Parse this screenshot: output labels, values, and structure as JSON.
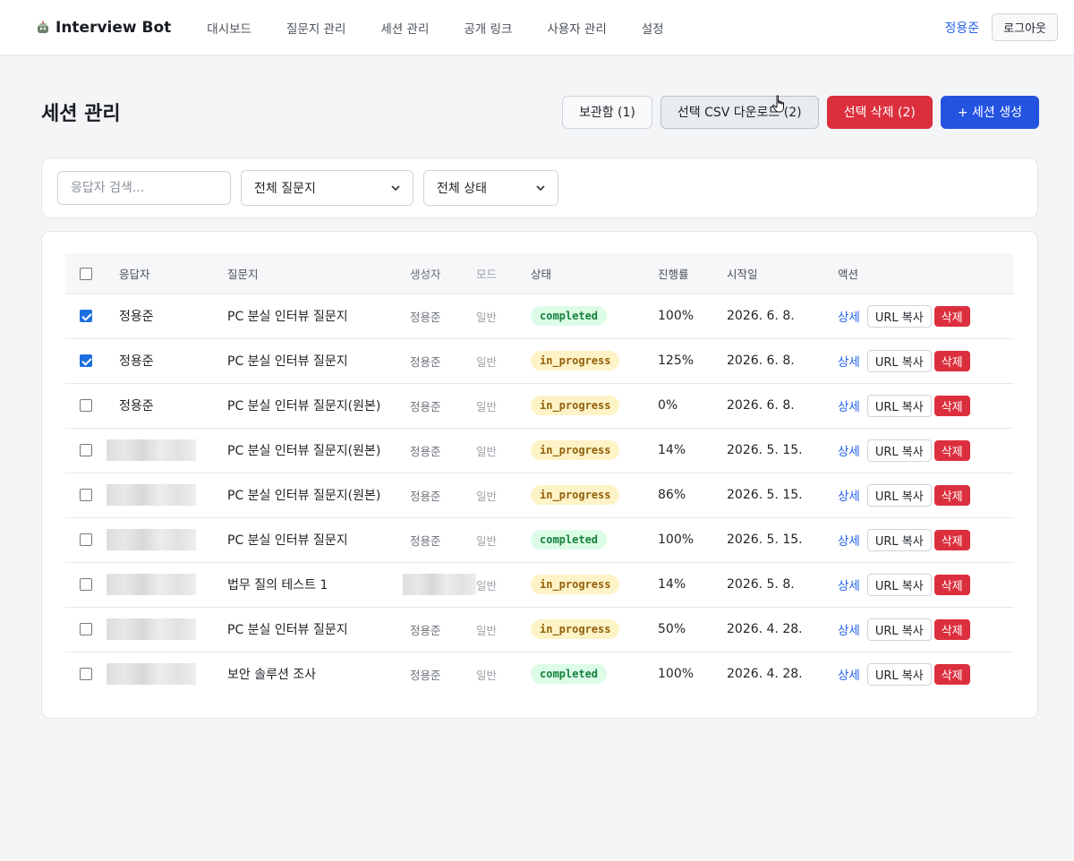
{
  "nav": {
    "brand": "Interview Bot",
    "links": [
      "대시보드",
      "질문지 관리",
      "세션 관리",
      "공개 링크",
      "사용자 관리",
      "설정"
    ],
    "user": "정용준",
    "logout": "로그아웃"
  },
  "header": {
    "title": "세션 관리",
    "archive_btn": "보관함 (1)",
    "csv_btn": "선택 CSV 다운로드 (2)",
    "delete_btn": "선택 삭제 (2)",
    "create_btn": "+ 세션 생성"
  },
  "filters": {
    "search_placeholder": "응답자 검색...",
    "questionnaire_select": "전체 질문지",
    "status_select": "전체 상태"
  },
  "table": {
    "headers": [
      "응답자",
      "질문지",
      "생성자",
      "모드",
      "상태",
      "진행률",
      "시작일",
      "액션"
    ],
    "detail_label": "상세",
    "url_label": "URL 복사",
    "delete_label": "삭제",
    "rows": [
      {
        "checked": true,
        "respondent": "정용준",
        "questionnaire": "PC 분실 인터뷰 질문지",
        "creator": "정용준",
        "mode": "일반",
        "status": "completed",
        "progress": "100%",
        "date": "2026. 6. 8."
      },
      {
        "checked": true,
        "respondent": "정용준",
        "questionnaire": "PC 분실 인터뷰 질문지",
        "creator": "정용준",
        "mode": "일반",
        "status": "in_progress",
        "progress": "125%",
        "date": "2026. 6. 8."
      },
      {
        "checked": false,
        "respondent": "정용준",
        "questionnaire": "PC 분실 인터뷰 질문지(원본)",
        "creator": "정용준",
        "mode": "일반",
        "status": "in_progress",
        "progress": "0%",
        "date": "2026. 6. 8."
      },
      {
        "checked": false,
        "respondent": "",
        "questionnaire": "PC 분실 인터뷰 질문지(원본)",
        "creator": "정용준",
        "mode": "일반",
        "status": "in_progress",
        "progress": "14%",
        "date": "2026. 5. 15."
      },
      {
        "checked": false,
        "respondent": "",
        "questionnaire": "PC 분실 인터뷰 질문지(원본)",
        "creator": "정용준",
        "mode": "일반",
        "status": "in_progress",
        "progress": "86%",
        "date": "2026. 5. 15."
      },
      {
        "checked": false,
        "respondent": "",
        "questionnaire": "PC 분실 인터뷰 질문지",
        "creator": "정용준",
        "mode": "일반",
        "status": "completed",
        "progress": "100%",
        "date": "2026. 5. 15."
      },
      {
        "checked": false,
        "respondent": "",
        "questionnaire": "법무 질의 테스트 1",
        "creator": "",
        "mode": "일반",
        "status": "in_progress",
        "progress": "14%",
        "date": "2026. 5. 8."
      },
      {
        "checked": false,
        "respondent": "",
        "questionnaire": "PC 분실 인터뷰 질문지",
        "creator": "정용준",
        "mode": "일반",
        "status": "in_progress",
        "progress": "50%",
        "date": "2026. 4. 28."
      },
      {
        "checked": false,
        "respondent": "",
        "questionnaire": "보안 솔루션 조사",
        "creator": "정용준",
        "mode": "일반",
        "status": "completed",
        "progress": "100%",
        "date": "2026. 4. 28."
      }
    ]
  },
  "icons": [
    "bot-icon",
    "chevron-down-icon",
    "hand-cursor-icon"
  ],
  "colors": {
    "primary": "#2453e0",
    "danger": "#dc2f3d",
    "link": "#2563eb",
    "completed": "#15803d",
    "in_progress": "#92600c"
  }
}
